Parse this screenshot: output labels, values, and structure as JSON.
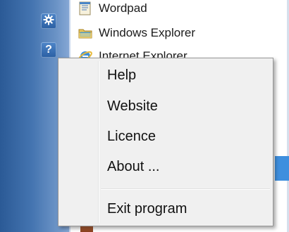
{
  "sidebar": {
    "buttons": [
      {
        "icon": "gear-icon",
        "color": "#2a5fa3"
      },
      {
        "icon": "help-icon",
        "glyph": "?",
        "color": "#2a5fa3"
      }
    ],
    "strip_color": "#4474b0"
  },
  "launcher": {
    "items": [
      {
        "label": "Wordpad",
        "icon": "wordpad-icon"
      },
      {
        "label": "Windows Explorer",
        "icon": "folder-icon"
      },
      {
        "label": "Internet Explorer",
        "icon": "internet-explorer-icon"
      }
    ],
    "highlight_color": "#3e8fde"
  },
  "context_menu": {
    "items": [
      {
        "label": "Help"
      },
      {
        "label": "Website"
      },
      {
        "label": "Licence"
      },
      {
        "label": "About ..."
      }
    ],
    "exit_label": "Exit program",
    "background": "#f0f0f0",
    "border": "#979797"
  }
}
